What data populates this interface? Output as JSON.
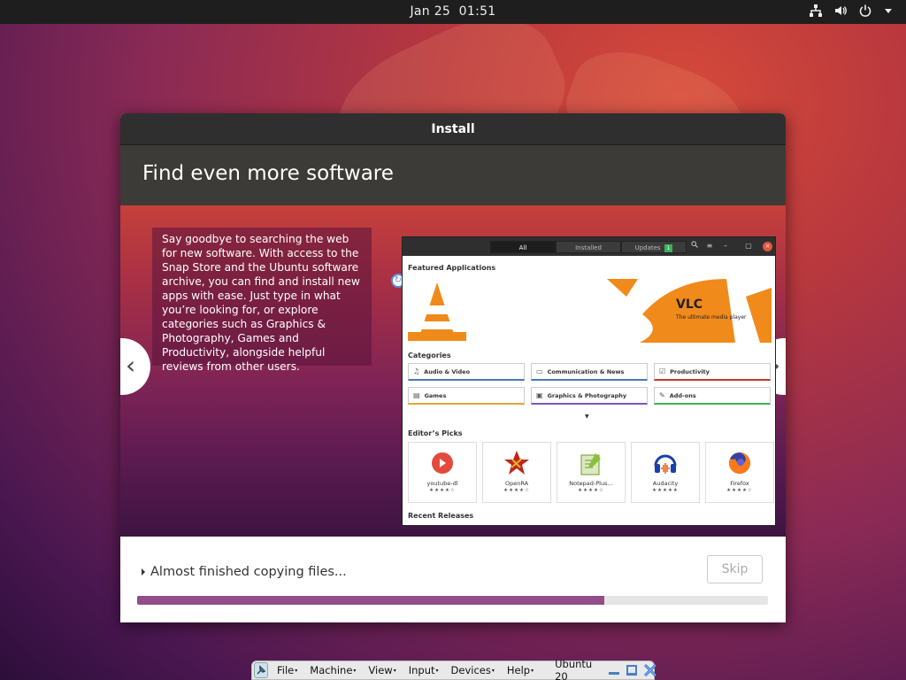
{
  "topbar": {
    "date": "Jan 25",
    "time": "01:51"
  },
  "dialog": {
    "title": "Install",
    "slide_heading": "Find even more software",
    "slide_text": "Say goodbye to searching the web for new software. With access to the Snap Store and the Ubuntu software archive, you can find and install new apps with ease. Just type in what you’re looking for, or explore categories such as Graphics & Photography, Games and Productivity, alongside helpful reviews from other users.",
    "nav_prev": "‹",
    "nav_next": "›",
    "status_text": "Almost finished copying files...",
    "skip_label": "Skip",
    "progress": 0.74
  },
  "snap_store": {
    "tabs": [
      "All",
      "Installed",
      "Updates"
    ],
    "updates_badge": "1",
    "featured_label": "Featured Applications",
    "featured_title": "VLC",
    "featured_subtitle": "The ultimate media player",
    "categories_label": "Categories",
    "categories": [
      {
        "label": "Audio & Video",
        "icon": "music-note-icon"
      },
      {
        "label": "Communication & News",
        "icon": "chat-icon"
      },
      {
        "label": "Productivity",
        "icon": "checklist-icon"
      },
      {
        "label": "Games",
        "icon": "game-icon"
      },
      {
        "label": "Graphics & Photography",
        "icon": "image-icon"
      },
      {
        "label": "Add-ons",
        "icon": "puzzle-icon"
      }
    ],
    "editors_picks_label": "Editor’s Picks",
    "picks": [
      {
        "name": "youtube-dl",
        "stars": "★★★★☆"
      },
      {
        "name": "OpenRA",
        "stars": "★★★★☆"
      },
      {
        "name": "Notepad-Plus...",
        "stars": "★★★★☆"
      },
      {
        "name": "Audacity",
        "stars": "★★★★★"
      },
      {
        "name": "Firefox",
        "stars": "★★★★☆"
      }
    ],
    "recent_label": "Recent Releases"
  },
  "vbox_menu": {
    "items": [
      "File",
      "Machine",
      "View",
      "Input",
      "Devices",
      "Help"
    ],
    "vm_name": "Ubuntu 20"
  },
  "colors": {
    "accent_progress": "#924d8b",
    "titlebar": "#2f2f2f",
    "header": "#3c3b37"
  }
}
